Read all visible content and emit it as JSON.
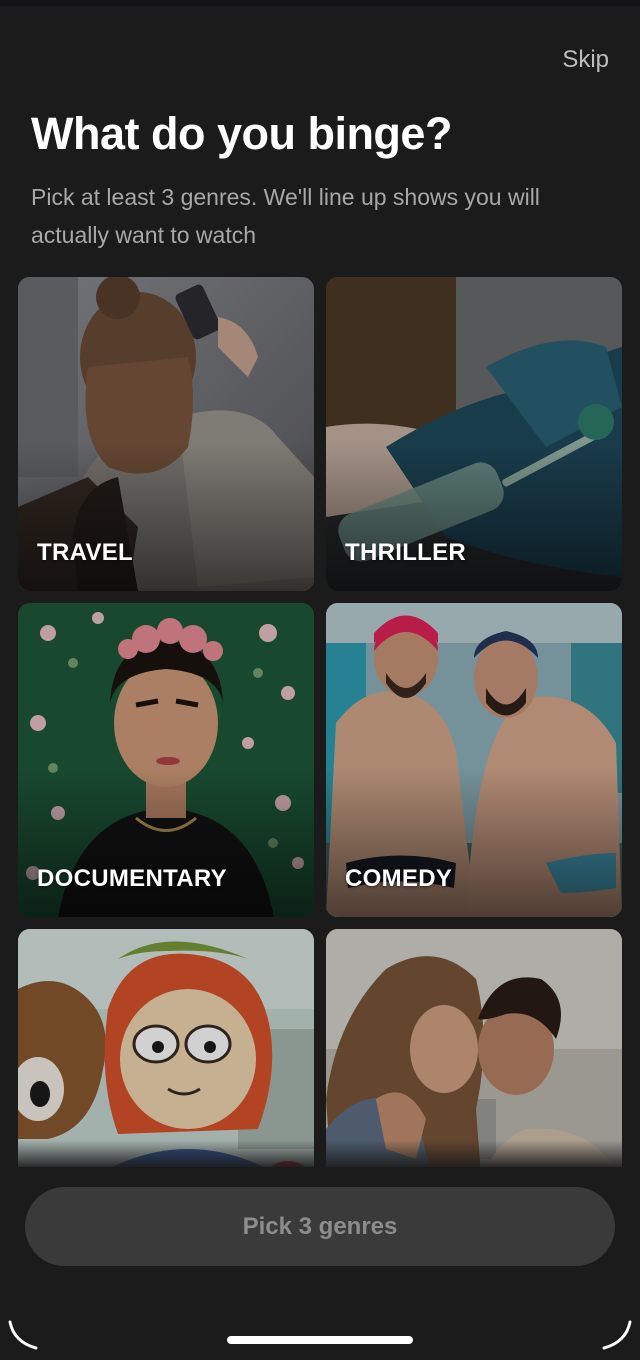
{
  "header": {
    "skip_label": "Skip",
    "title": "What do you binge?",
    "subtitle": "Pick at least 3 genres. We'll line up shows you will actually want to watch"
  },
  "genres": [
    {
      "label": "TRAVEL",
      "selected": false
    },
    {
      "label": "THRILLER",
      "selected": false
    },
    {
      "label": "DOCUMENTARY",
      "selected": false
    },
    {
      "label": "COMEDY",
      "selected": false
    },
    {
      "label": "",
      "selected": false
    },
    {
      "label": "",
      "selected": false
    }
  ],
  "cta": {
    "label": "Pick 3 genres",
    "enabled": false
  },
  "colors": {
    "background": "#1b1b1c",
    "cta_disabled_bg": "#3a3a3b",
    "cta_disabled_text": "#8c8c8c",
    "muted_text": "#a8a8a8"
  }
}
